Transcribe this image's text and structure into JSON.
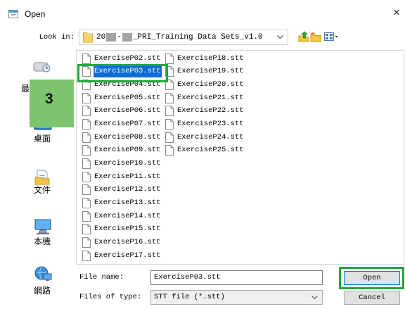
{
  "window": {
    "title": "Open",
    "close": "×",
    "title_icon": "open-dialog-icon"
  },
  "look_in": {
    "label": "Look in:",
    "folder_icon": "folder-icon",
    "path_segments": [
      "20",
      "-",
      "_PRI_Training Data Sets_v1.0"
    ]
  },
  "toolbar": {
    "icons": [
      "up-one-level-icon",
      "new-folder-icon",
      "view-menu-icon"
    ]
  },
  "places": [
    {
      "icon": "recent-places-icon",
      "label": "最"
    },
    {
      "icon": "desktop-icon",
      "label": "桌面"
    },
    {
      "icon": "documents-icon",
      "label": "文件"
    },
    {
      "icon": "computer-icon",
      "label": "本機"
    },
    {
      "icon": "network-icon",
      "label": "網路"
    }
  ],
  "files": {
    "icon": "stt-file-icon",
    "columns": [
      [
        "ExerciseP02.stt",
        "ExerciseP03.stt",
        "ExerciseP04.stt",
        "ExerciseP05.stt",
        "ExerciseP06.stt",
        "ExerciseP07.stt",
        "ExerciseP08.stt",
        "ExerciseP09.stt",
        "ExerciseP10.stt",
        "ExerciseP11.stt",
        "ExerciseP12.stt",
        "ExerciseP13.stt",
        "ExerciseP14.stt",
        "ExerciseP15.stt",
        "ExerciseP16.stt",
        "ExerciseP17.stt"
      ],
      [
        "ExerciseP18.stt",
        "ExerciseP19.stt",
        "ExerciseP20.stt",
        "ExerciseP21.stt",
        "ExerciseP22.stt",
        "ExerciseP23.stt",
        "ExerciseP24.stt",
        "ExerciseP25.stt"
      ]
    ],
    "selected": "ExerciseP03.stt"
  },
  "file_name": {
    "label": "File name:",
    "value": "ExerciseP03.stt"
  },
  "file_type": {
    "label": "Files of type:",
    "value": "STT file (*.stt)"
  },
  "buttons": {
    "open": "Open",
    "cancel": "Cancel"
  },
  "annotation": {
    "step_number": "3"
  },
  "colors": {
    "annotation_outline": "#22a63a",
    "step_marker_fill": "#7cc46d",
    "selection": "#0f6bd7",
    "default_button_border": "#0078d7"
  }
}
